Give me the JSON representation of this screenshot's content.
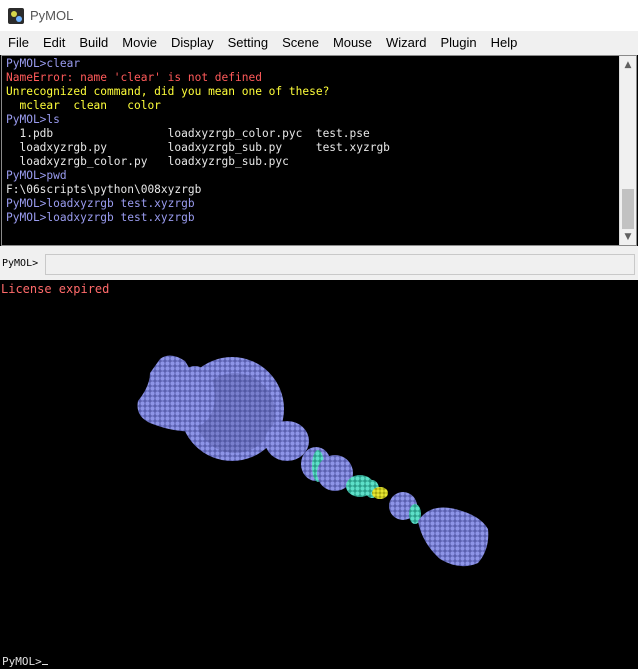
{
  "window": {
    "title": "PyMOL",
    "icon": "pymol-app-icon"
  },
  "menu": [
    "File",
    "Edit",
    "Build",
    "Movie",
    "Display",
    "Setting",
    "Scene",
    "Mouse",
    "Wizard",
    "Plugin",
    "Help"
  ],
  "console": {
    "lines": [
      {
        "kind": "prompt",
        "text": "PyMOL>clear"
      },
      {
        "kind": "error",
        "text": "NameError: name 'clear' is not defined"
      },
      {
        "kind": "warn",
        "text": "Unrecognized command, did you mean one of these?"
      },
      {
        "kind": "warn",
        "text": "  mclear  clean   color"
      },
      {
        "kind": "prompt",
        "text": "PyMOL>ls"
      },
      {
        "kind": "out",
        "text": "  1.pdb                 loadxyzrgb_color.pyc  test.pse"
      },
      {
        "kind": "out",
        "text": "  loadxyzrgb.py         loadxyzrgb_sub.py     test.xyzrgb"
      },
      {
        "kind": "out",
        "text": "  loadxyzrgb_color.py   loadxyzrgb_sub.pyc"
      },
      {
        "kind": "prompt",
        "text": "PyMOL>pwd"
      },
      {
        "kind": "out",
        "text": "F:\\06scripts\\python\\008xyzrgb"
      },
      {
        "kind": "prompt",
        "text": "PyMOL>loadxyzrgb test.xyzrgb"
      },
      {
        "kind": "prompt",
        "text": "PyMOL>loadxyzrgb test.xyzrgb"
      }
    ],
    "colors": {
      "prompt": "#9a9cf0",
      "error": "#ff5a5a",
      "warn": "#ffff3a",
      "out": "#e8e8e8"
    }
  },
  "command": {
    "label": "PyMOL>",
    "value": ""
  },
  "viewer": {
    "license_text": "License expired",
    "colors": {
      "blue": "#7f86d9",
      "cyan": "#4fd6c0",
      "yellow": "#d8d820"
    }
  },
  "bottom_prompt": "PyMOL>"
}
